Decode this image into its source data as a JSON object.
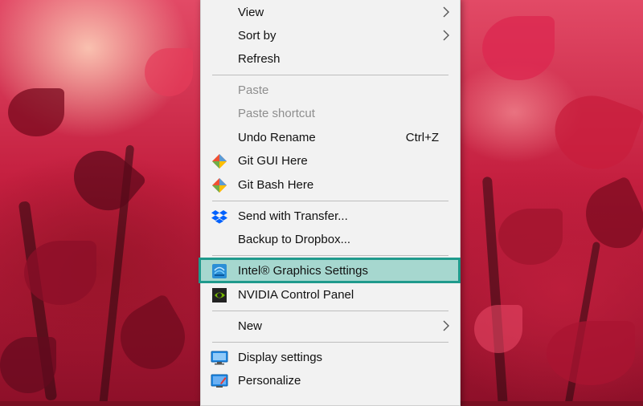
{
  "colors": {
    "menu_bg": "#f2f2f2",
    "highlight_fill": "#a6d7cf",
    "highlight_border": "#1f9a8c",
    "disabled_text": "#8e8e8e",
    "wallpaper_accent": "#d8294b"
  },
  "menu": {
    "items": [
      {
        "label": "View",
        "icon": "",
        "submenu": true
      },
      {
        "label": "Sort by",
        "icon": "",
        "submenu": true
      },
      {
        "label": "Refresh",
        "icon": ""
      },
      {
        "label": "Paste",
        "icon": "",
        "disabled": true
      },
      {
        "label": "Paste shortcut",
        "icon": "",
        "disabled": true
      },
      {
        "label": "Undo Rename",
        "icon": "",
        "shortcut": "Ctrl+Z"
      },
      {
        "label": "Git GUI Here",
        "icon": "git-diamond-icon"
      },
      {
        "label": "Git Bash Here",
        "icon": "git-diamond-icon"
      },
      {
        "label": "Send with Transfer...",
        "icon": "dropbox-icon"
      },
      {
        "label": "Backup to Dropbox...",
        "icon": ""
      },
      {
        "label": "Intel® Graphics Settings",
        "icon": "intel-graphics-icon",
        "highlighted": true
      },
      {
        "label": "NVIDIA Control Panel",
        "icon": "nvidia-icon"
      },
      {
        "label": "New",
        "icon": "",
        "submenu": true
      },
      {
        "label": "Display settings",
        "icon": "monitor-icon"
      },
      {
        "label": "Personalize",
        "icon": "personalize-icon"
      }
    ]
  }
}
